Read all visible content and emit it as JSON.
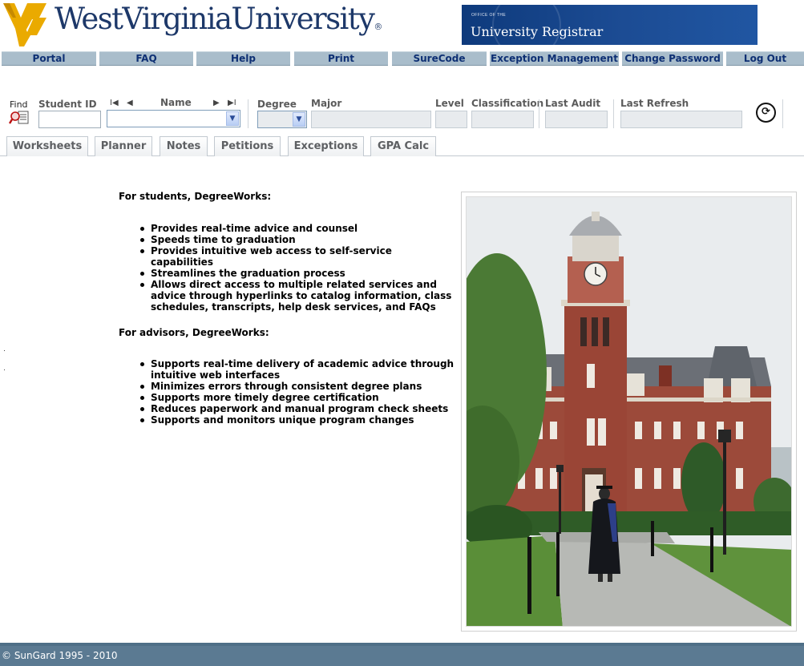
{
  "header": {
    "logo_text": "WestVirginiaUniversity",
    "logo_mark": "®",
    "registrar_office": "OFFICE OF THE",
    "registrar_title": "University Registrar"
  },
  "nav": {
    "items": [
      {
        "label": "Portal"
      },
      {
        "label": "FAQ"
      },
      {
        "label": "Help"
      },
      {
        "label": "Print"
      },
      {
        "label": "SureCode"
      },
      {
        "label": "Exception Management"
      },
      {
        "label": "Change Password"
      },
      {
        "label": "Log Out"
      }
    ]
  },
  "student_bar": {
    "find_label": "Find",
    "student_id_label": "Student ID",
    "student_id_value": "",
    "name_label": "Name",
    "name_value": "",
    "degree_label": "Degree",
    "degree_value": "",
    "major_label": "Major",
    "major_value": "",
    "level_label": "Level",
    "level_value": "",
    "classification_label": "Classification",
    "classification_value": "",
    "last_audit_label": "Last Audit",
    "last_audit_value": "",
    "last_refresh_label": "Last Refresh",
    "last_refresh_value": "",
    "nav_first": "I◀",
    "nav_prev": "◀",
    "nav_next": "▶",
    "nav_last": "▶I"
  },
  "tabs": [
    {
      "label": "Worksheets"
    },
    {
      "label": "Planner"
    },
    {
      "label": "Notes"
    },
    {
      "label": "Petitions"
    },
    {
      "label": "Exceptions"
    },
    {
      "label": "GPA Calc"
    }
  ],
  "content": {
    "students_heading": "For students, DegreeWorks:",
    "students_points": [
      "Provides real-time advice and counsel",
      "Speeds time to graduation",
      "Provides intuitive web access to self-service capabilities",
      "Streamlines the graduation process",
      "Allows direct access to multiple related services and advice through hyperlinks to catalog information, class schedules, transcripts, help desk services, and FAQs"
    ],
    "advisors_heading": "For advisors, DegreeWorks:",
    "advisors_points": [
      "Supports real-time delivery of academic advice through intuitive web interfaces",
      "Minimizes errors through consistent degree plans",
      "Supports more timely degree certification",
      "Reduces paperwork and manual program check sheets",
      "Supports and monitors unique program changes"
    ]
  },
  "footer": {
    "copyright": "© SunGard 1995 - 2010"
  },
  "colors": {
    "brand_navy": "#1d3869",
    "brand_gold": "#eaaa00",
    "nav_bg": "#a9bdcb",
    "nav_text": "#0d2f73",
    "footer_bg": "#5b7a92"
  }
}
